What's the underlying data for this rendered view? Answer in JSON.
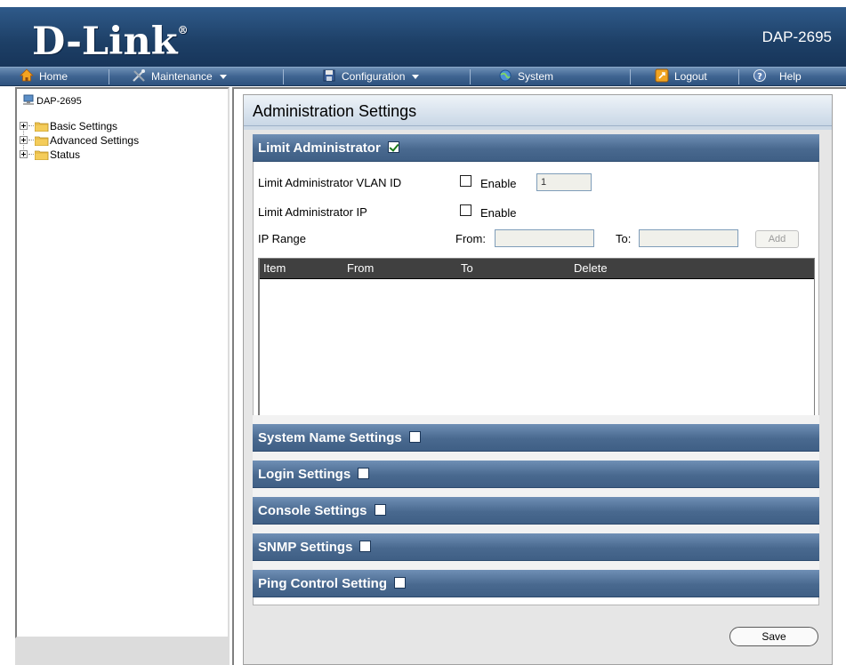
{
  "header": {
    "logo": "D-Link",
    "logo_reg": "®",
    "model": "DAP-2695"
  },
  "menu": [
    {
      "label": "Home",
      "icon": "home-icon"
    },
    {
      "label": "Maintenance",
      "icon": "tools-icon",
      "has_dropdown": true
    },
    {
      "label": "Configuration",
      "icon": "disk-icon",
      "has_dropdown": true
    },
    {
      "label": "System",
      "icon": "globe-icon"
    },
    {
      "label": "Logout",
      "icon": "logout-icon"
    },
    {
      "label": "Help",
      "icon": "help-icon"
    }
  ],
  "tree": {
    "root": "DAP-2695",
    "nodes": [
      "Basic Settings",
      "Advanced Settings",
      "Status"
    ]
  },
  "page": {
    "title": "Administration Settings"
  },
  "limit_admin": {
    "title": "Limit Administrator",
    "checked": true,
    "vlan_label": "Limit Administrator VLAN ID",
    "vlan_enable_label": "Enable",
    "vlan_value": "1",
    "ip_label": "Limit Administrator IP",
    "ip_enable_label": "Enable",
    "range_label": "IP Range",
    "from_label": "From:",
    "to_label": "To:",
    "from_value": "",
    "to_value": "",
    "add_label": "Add",
    "table_headers": [
      "Item",
      "From",
      "To",
      "Delete"
    ],
    "table_rows": []
  },
  "sections": [
    {
      "title": "System Name Settings",
      "checked": false
    },
    {
      "title": "Login Settings",
      "checked": false
    },
    {
      "title": "Console Settings",
      "checked": false
    },
    {
      "title": "SNMP Settings",
      "checked": false
    },
    {
      "title": "Ping Control Setting",
      "checked": false
    }
  ],
  "save_label": "Save",
  "colors": {
    "header_bg": "#1d3f66",
    "section_bar": "#49698f",
    "table_header": "#404040"
  }
}
